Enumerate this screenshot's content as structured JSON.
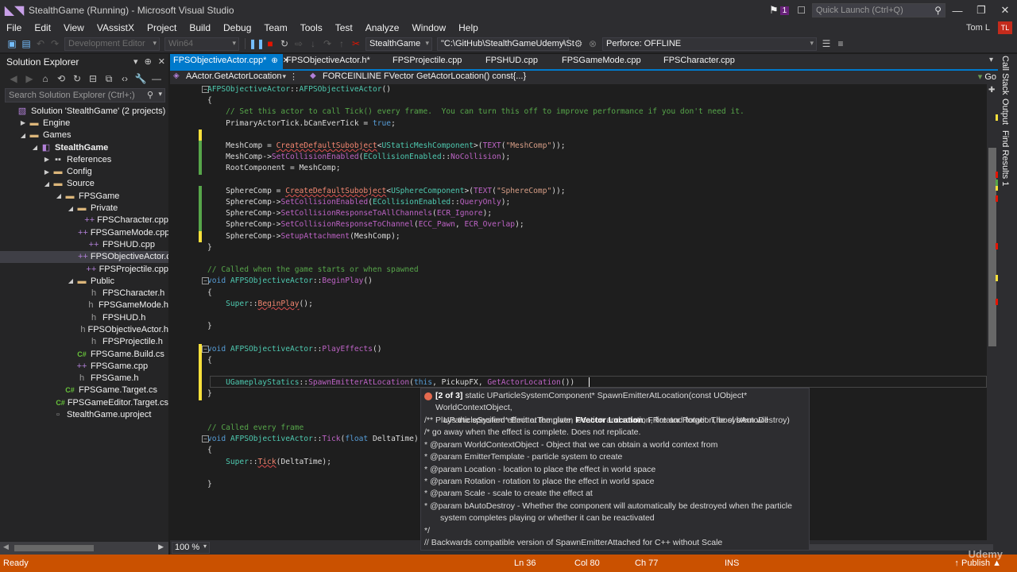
{
  "window": {
    "title": "StealthGame (Running) - Microsoft Visual Studio",
    "notification_count": "1",
    "quick_launch_placeholder": "Quick Launch (Ctrl+Q)",
    "user": "Tom L",
    "user_initials": "TL",
    "min": "—",
    "restore": "❐",
    "close": "✕"
  },
  "menu": [
    "File",
    "Edit",
    "View",
    "VAssistX",
    "Project",
    "Build",
    "Debug",
    "Team",
    "Tools",
    "Test",
    "Analyze",
    "Window",
    "Help"
  ],
  "toolbar": {
    "configuration": "Development Editor",
    "platform": "Win64",
    "startup_project": "StealthGame",
    "path": "\"C:\\GitHub\\StealthGameUdemy\\St",
    "perforce": "Perforce: OFFLINE"
  },
  "solution_explorer": {
    "title": "Solution Explorer",
    "search_placeholder": "Search Solution Explorer (Ctrl+;)",
    "items": [
      {
        "label": "Solution 'StealthGame' (2 projects)",
        "depth": 0,
        "arrow": "",
        "icon": "sln",
        "bold": false
      },
      {
        "label": "Engine",
        "depth": 1,
        "arrow": "▶",
        "icon": "folder",
        "bold": false
      },
      {
        "label": "Games",
        "depth": 1,
        "arrow": "◢",
        "icon": "folder",
        "bold": false
      },
      {
        "label": "StealthGame",
        "depth": 2,
        "arrow": "◢",
        "icon": "project",
        "bold": true
      },
      {
        "label": "References",
        "depth": 3,
        "arrow": "▶",
        "icon": "ref",
        "bold": false
      },
      {
        "label": "Config",
        "depth": 3,
        "arrow": "▶",
        "icon": "folder",
        "bold": false
      },
      {
        "label": "Source",
        "depth": 3,
        "arrow": "◢",
        "icon": "folder",
        "bold": false
      },
      {
        "label": "FPSGame",
        "depth": 4,
        "arrow": "◢",
        "icon": "folder",
        "bold": false
      },
      {
        "label": "Private",
        "depth": 5,
        "arrow": "◢",
        "icon": "folder",
        "bold": false
      },
      {
        "label": "FPSCharacter.cpp",
        "depth": 6,
        "arrow": "",
        "icon": "cpp",
        "bold": false
      },
      {
        "label": "FPSGameMode.cpp",
        "depth": 6,
        "arrow": "",
        "icon": "cpp",
        "bold": false
      },
      {
        "label": "FPSHUD.cpp",
        "depth": 6,
        "arrow": "",
        "icon": "cpp",
        "bold": false
      },
      {
        "label": "FPSObjectiveActor.cpp",
        "depth": 6,
        "arrow": "",
        "icon": "cpp",
        "bold": false,
        "selected": true
      },
      {
        "label": "FPSProjectile.cpp",
        "depth": 6,
        "arrow": "",
        "icon": "cpp",
        "bold": false
      },
      {
        "label": "Public",
        "depth": 5,
        "arrow": "◢",
        "icon": "folder",
        "bold": false
      },
      {
        "label": "FPSCharacter.h",
        "depth": 6,
        "arrow": "",
        "icon": "h",
        "bold": false
      },
      {
        "label": "FPSGameMode.h",
        "depth": 6,
        "arrow": "",
        "icon": "h",
        "bold": false
      },
      {
        "label": "FPSHUD.h",
        "depth": 6,
        "arrow": "",
        "icon": "h",
        "bold": false
      },
      {
        "label": "FPSObjectiveActor.h",
        "depth": 6,
        "arrow": "",
        "icon": "h",
        "bold": false
      },
      {
        "label": "FPSProjectile.h",
        "depth": 6,
        "arrow": "",
        "icon": "h",
        "bold": false
      },
      {
        "label": "FPSGame.Build.cs",
        "depth": 5,
        "arrow": "",
        "icon": "cs",
        "bold": false
      },
      {
        "label": "FPSGame.cpp",
        "depth": 5,
        "arrow": "",
        "icon": "cpp",
        "bold": false
      },
      {
        "label": "FPSGame.h",
        "depth": 5,
        "arrow": "",
        "icon": "h",
        "bold": false
      },
      {
        "label": "FPSGame.Target.cs",
        "depth": 4,
        "arrow": "",
        "icon": "cs",
        "bold": false
      },
      {
        "label": "FPSGameEditor.Target.cs",
        "depth": 4,
        "arrow": "",
        "icon": "cs",
        "bold": false
      },
      {
        "label": "StealthGame.uproject",
        "depth": 3,
        "arrow": "",
        "icon": "uproject",
        "bold": false
      }
    ]
  },
  "tabs": [
    {
      "label": "FPSObjectiveActor.cpp*",
      "active": true,
      "pin": "⊕",
      "close": "✕"
    },
    {
      "label": "FPSObjectiveActor.h*",
      "active": false,
      "pin": "",
      "close": ""
    },
    {
      "label": "FPSProjectile.cpp",
      "active": false,
      "pin": "",
      "close": ""
    },
    {
      "label": "FPSHUD.cpp",
      "active": false,
      "pin": "",
      "close": ""
    },
    {
      "label": "FPSGameMode.cpp",
      "active": false,
      "pin": "",
      "close": ""
    },
    {
      "label": "FPSCharacter.cpp",
      "active": false,
      "pin": "",
      "close": ""
    }
  ],
  "navbar": {
    "scope": "AActor.GetActorLocation",
    "member": "FORCEINLINE FVector GetActorLocation() const{...}",
    "go": "Go"
  },
  "code_lines": [
    [
      [
        "AFPSObjectiveActor",
        "ty"
      ],
      [
        "::",
        "pl"
      ],
      [
        "AFPSObjectiveActor",
        "ty"
      ],
      [
        "()",
        "pl"
      ]
    ],
    [
      [
        "{",
        "pl"
      ]
    ],
    [
      [
        "    // Set this actor to call Tick() every frame.  You can turn this off to improve performance if you don't need it.",
        "cm"
      ]
    ],
    [
      [
        "    PrimaryActorTick",
        "pl"
      ],
      [
        ".",
        "pl"
      ],
      [
        "bCanEverTick",
        "pl"
      ],
      [
        " = ",
        "pl"
      ],
      [
        "true",
        "kw"
      ],
      [
        ";",
        "pl"
      ]
    ],
    [
      [
        "",
        "pl"
      ]
    ],
    [
      [
        "    MeshComp",
        "pl"
      ],
      [
        " = ",
        "pl"
      ],
      [
        "CreateDefaultSubobject",
        "red"
      ],
      [
        "<",
        "pl"
      ],
      [
        "UStaticMeshComponent",
        "ty"
      ],
      [
        ">(",
        "pl"
      ],
      [
        "TEXT",
        "ma"
      ],
      [
        "(",
        "pl"
      ],
      [
        "\"MeshComp\"",
        "st"
      ],
      [
        "));",
        "pl"
      ]
    ],
    [
      [
        "    MeshComp",
        "pl"
      ],
      [
        "->",
        "pl"
      ],
      [
        "SetCollisionEnabled",
        "ma"
      ],
      [
        "(",
        "pl"
      ],
      [
        "ECollisionEnabled",
        "ty"
      ],
      [
        "::",
        "pl"
      ],
      [
        "NoCollision",
        "ma"
      ],
      [
        ");",
        "pl"
      ]
    ],
    [
      [
        "    RootComponent",
        "pl"
      ],
      [
        " = ",
        "pl"
      ],
      [
        "MeshComp",
        "pl"
      ],
      [
        ";",
        "pl"
      ]
    ],
    [
      [
        "",
        "pl"
      ]
    ],
    [
      [
        "    SphereComp",
        "pl"
      ],
      [
        " = ",
        "pl"
      ],
      [
        "CreateDefaultSubobject",
        "red"
      ],
      [
        "<",
        "pl"
      ],
      [
        "USphereComponent",
        "ty"
      ],
      [
        ">(",
        "pl"
      ],
      [
        "TEXT",
        "ma"
      ],
      [
        "(",
        "pl"
      ],
      [
        "\"SphereComp\"",
        "st"
      ],
      [
        "));",
        "pl"
      ]
    ],
    [
      [
        "    SphereComp",
        "pl"
      ],
      [
        "->",
        "pl"
      ],
      [
        "SetCollisionEnabled",
        "ma"
      ],
      [
        "(",
        "pl"
      ],
      [
        "ECollisionEnabled",
        "ty"
      ],
      [
        "::",
        "pl"
      ],
      [
        "QueryOnly",
        "ma"
      ],
      [
        ");",
        "pl"
      ]
    ],
    [
      [
        "    SphereComp",
        "pl"
      ],
      [
        "->",
        "pl"
      ],
      [
        "SetCollisionResponseToAllChannels",
        "ma"
      ],
      [
        "(",
        "pl"
      ],
      [
        "ECR_Ignore",
        "ma"
      ],
      [
        ");",
        "pl"
      ]
    ],
    [
      [
        "    SphereComp",
        "pl"
      ],
      [
        "->",
        "pl"
      ],
      [
        "SetCollisionResponseToChannel",
        "ma"
      ],
      [
        "(",
        "pl"
      ],
      [
        "ECC_Pawn",
        "ma"
      ],
      [
        ", ",
        "pl"
      ],
      [
        "ECR_Overlap",
        "ma"
      ],
      [
        ");",
        "pl"
      ]
    ],
    [
      [
        "    SphereComp",
        "pl"
      ],
      [
        "->",
        "pl"
      ],
      [
        "SetupAttachment",
        "ma"
      ],
      [
        "(",
        "pl"
      ],
      [
        "MeshComp",
        "pl"
      ],
      [
        ");",
        "pl"
      ]
    ],
    [
      [
        "}",
        "pl"
      ]
    ],
    [
      [
        "",
        "pl"
      ]
    ],
    [
      [
        "// Called when the game starts or when spawned",
        "cm"
      ]
    ],
    [
      [
        "void",
        "kw"
      ],
      [
        " ",
        "pl"
      ],
      [
        "AFPSObjectiveActor",
        "ty"
      ],
      [
        "::",
        "pl"
      ],
      [
        "BeginPlay",
        "ma"
      ],
      [
        "()",
        "pl"
      ]
    ],
    [
      [
        "{",
        "pl"
      ]
    ],
    [
      [
        "    Super",
        "ty"
      ],
      [
        "::",
        "pl"
      ],
      [
        "BeginPlay",
        "red"
      ],
      [
        "();",
        "pl"
      ]
    ],
    [
      [
        "",
        "pl"
      ]
    ],
    [
      [
        "}",
        "pl"
      ]
    ],
    [
      [
        "",
        "pl"
      ]
    ],
    [
      [
        "void",
        "kw"
      ],
      [
        " ",
        "pl"
      ],
      [
        "AFPSObjectiveActor",
        "ty"
      ],
      [
        "::",
        "pl"
      ],
      [
        "PlayEffects",
        "ma"
      ],
      [
        "()",
        "pl"
      ]
    ],
    [
      [
        "{",
        "pl"
      ]
    ],
    [
      [
        "",
        "pl"
      ]
    ],
    [
      [
        "    UGameplayStatics",
        "ty"
      ],
      [
        "::",
        "pl"
      ],
      [
        "SpawnEmitterAtLocation",
        "ma"
      ],
      [
        "(",
        "pl"
      ],
      [
        "this",
        "kw"
      ],
      [
        ", ",
        "pl"
      ],
      [
        "PickupFX",
        "pl"
      ],
      [
        ", ",
        "pl"
      ],
      [
        "GetActorLocation",
        "ma"
      ],
      [
        "())",
        "pl"
      ]
    ],
    [
      [
        "}",
        "pl"
      ]
    ],
    [
      [
        "",
        "pl"
      ]
    ],
    [
      [
        "",
        "pl"
      ]
    ],
    [
      [
        "// Called every frame",
        "cm"
      ]
    ],
    [
      [
        "void",
        "kw"
      ],
      [
        " ",
        "pl"
      ],
      [
        "AFPSObjectiveActor",
        "ty"
      ],
      [
        "::",
        "pl"
      ],
      [
        "Tick",
        "ma"
      ],
      [
        "(",
        "pl"
      ],
      [
        "float",
        "kw"
      ],
      [
        " DeltaTime)",
        "pl"
      ]
    ],
    [
      [
        "{",
        "pl"
      ]
    ],
    [
      [
        "    Super",
        "ty"
      ],
      [
        "::",
        "pl"
      ],
      [
        "Tick",
        "red"
      ],
      [
        "(",
        "pl"
      ],
      [
        "DeltaTime",
        "pl"
      ],
      [
        ");",
        "pl"
      ]
    ],
    [
      [
        "",
        "pl"
      ]
    ],
    [
      [
        "}",
        "pl"
      ]
    ]
  ],
  "tooltip": {
    "overload": "[2 of 3]",
    "sig_part1": " static UParticleSystemComponent* SpawnEmitterAtLocation(const UObject* WorldContextObject,",
    "sig_part2a": "UParticleSystem* EmitterTemplate, ",
    "sig_bold": "FVector Location",
    "sig_part2b": ", FRotator Rotation, bool bAutoDestroy)",
    "doc": [
      "/** Plays the specified effect at the given location and rotation, fire and forget. The system will",
      "/* go away when the effect is complete. Does not replicate.",
      "* @param WorldContextObject - Object that we can obtain a world context from",
      "* @param EmitterTemplate - particle system to create",
      "* @param Location - location to place the effect in world space",
      "* @param Rotation - rotation to place the effect in world space",
      "* @param Scale - scale to create the effect at",
      "* @param bAutoDestroy - Whether the component will automatically be destroyed when the particle",
      "system completes playing or whether it can be reactivated",
      "*/",
      "// Backwards compatible version of SpawnEmitterAttached for C++ without Scale"
    ]
  },
  "zoom": "100 %",
  "right_dock": [
    "Call Stack",
    "Output",
    "Find Results 1"
  ],
  "status": {
    "text": "Ready",
    "line": "Ln 36",
    "col": "Col 80",
    "ch": "Ch 77",
    "mode": "INS",
    "publish": "↑ Publish ▲"
  },
  "watermark": "Udemy",
  "colors": {
    "accent": "#007acc",
    "status_bar": "#ca5100",
    "error_squiggle": "#e05050"
  }
}
